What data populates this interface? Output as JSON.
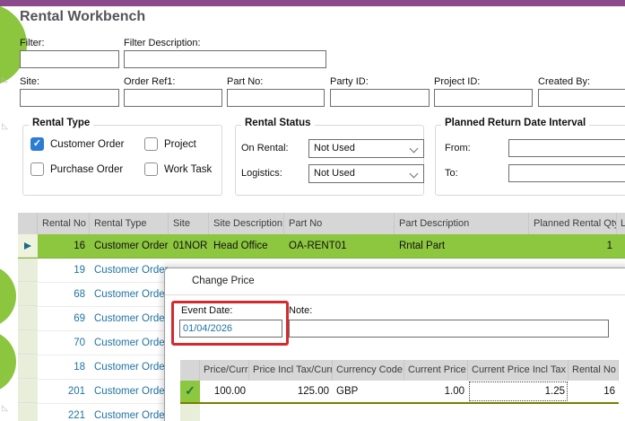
{
  "window": {
    "title": "Rental Workbench"
  },
  "filters": {
    "filter_label": "Filter:",
    "filter_value": "",
    "filter_description_label": "Filter Description:",
    "filter_description_value": "",
    "site_label": "Site:",
    "site_value": "",
    "order_ref1_label": "Order Ref1:",
    "order_ref1_value": "",
    "part_no_label": "Part No:",
    "part_no_value": "",
    "party_id_label": "Party ID:",
    "party_id_value": "",
    "project_id_label": "Project ID:",
    "project_id_value": "",
    "created_by_label": "Created By:",
    "created_by_value": ""
  },
  "rental_type": {
    "title": "Rental Type",
    "options": [
      {
        "label": "Customer Order",
        "checked": true
      },
      {
        "label": "Project",
        "checked": false
      },
      {
        "label": "Purchase Order",
        "checked": false
      },
      {
        "label": "Work Task",
        "checked": false
      }
    ]
  },
  "rental_status": {
    "title": "Rental Status",
    "on_rental_label": "On Rental:",
    "on_rental_value": "Not Used",
    "logistics_label": "Logistics:",
    "logistics_value": "Not Used"
  },
  "planned_return": {
    "title": "Planned Return Date Interval",
    "from_label": "From:",
    "from_value": "",
    "to_label": "To:",
    "to_value": ""
  },
  "grid": {
    "columns": [
      "Rental No",
      "Rental Type",
      "Site",
      "Site Description",
      "Part No",
      "Part Description",
      "Planned Rental Qty",
      "L"
    ],
    "rows": [
      {
        "rental_no": "16",
        "rental_type": "Customer Order",
        "site": "01NOR",
        "site_description": "Head Office",
        "part_no": "OA-RENT01",
        "part_description": "Rntal Part",
        "planned_rental_qty": "1",
        "selected": true
      },
      {
        "rental_no": "19",
        "rental_type": "Customer Order"
      },
      {
        "rental_no": "68",
        "rental_type": "Customer Order"
      },
      {
        "rental_no": "69",
        "rental_type": "Customer Order"
      },
      {
        "rental_no": "70",
        "rental_type": "Customer Order"
      },
      {
        "rental_no": "18",
        "rental_type": "Customer Order"
      },
      {
        "rental_no": "201",
        "rental_type": "Customer Order"
      },
      {
        "rental_no": "221",
        "rental_type": "Customer Order"
      }
    ]
  },
  "dialog": {
    "title": "Change Price",
    "event_date": {
      "label": "Event Date:",
      "value": "01/04/2026"
    },
    "note": {
      "label": "Note:",
      "value": ""
    },
    "table": {
      "columns": [
        "Price/Curr",
        "Price Incl Tax/Curr",
        "Currency Code",
        "Current Price",
        "Current Price Incl Tax",
        "Rental No"
      ],
      "rows": [
        {
          "price_curr": "100.00",
          "price_incl_tax_curr": "125.00",
          "currency_code": "GBP",
          "current_price": "1.00",
          "current_price_incl_tax": "1.25",
          "rental_no": "16"
        }
      ]
    }
  },
  "colors": {
    "accent_purple": "#8a4a8c",
    "selection_green": "#8dc63f",
    "link_blue": "#1f73a1",
    "annotation_red": "#d42a2e"
  }
}
